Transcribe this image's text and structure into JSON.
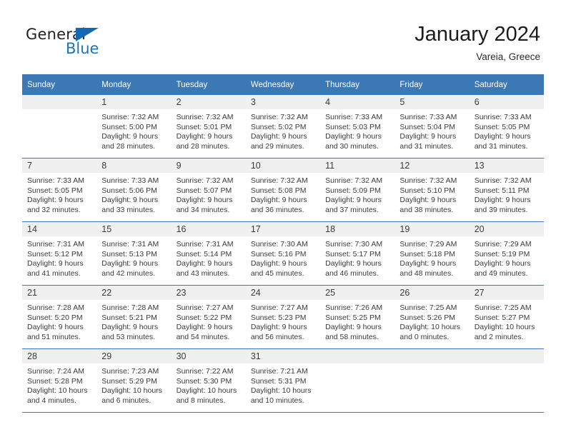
{
  "brand": {
    "name_top": "General",
    "name_bottom": "Blue",
    "triangle_color": "#1268b3",
    "blue_text_color": "#1b75bb"
  },
  "header": {
    "month_title": "January 2024",
    "location": "Vareia, Greece"
  },
  "colors": {
    "header_blue": "#3b78b5",
    "daynum_band": "#f0f0f0",
    "text": "#3a3a3a"
  },
  "weekday_headers": [
    "Sunday",
    "Monday",
    "Tuesday",
    "Wednesday",
    "Thursday",
    "Friday",
    "Saturday"
  ],
  "weeks": [
    [
      {
        "day": "",
        "sunrise": "",
        "sunset": "",
        "daylight_line1": "",
        "daylight_line2": ""
      },
      {
        "day": "1",
        "sunrise": "Sunrise: 7:32 AM",
        "sunset": "Sunset: 5:00 PM",
        "daylight_line1": "Daylight: 9 hours",
        "daylight_line2": "and 28 minutes."
      },
      {
        "day": "2",
        "sunrise": "Sunrise: 7:32 AM",
        "sunset": "Sunset: 5:01 PM",
        "daylight_line1": "Daylight: 9 hours",
        "daylight_line2": "and 28 minutes."
      },
      {
        "day": "3",
        "sunrise": "Sunrise: 7:32 AM",
        "sunset": "Sunset: 5:02 PM",
        "daylight_line1": "Daylight: 9 hours",
        "daylight_line2": "and 29 minutes."
      },
      {
        "day": "4",
        "sunrise": "Sunrise: 7:33 AM",
        "sunset": "Sunset: 5:03 PM",
        "daylight_line1": "Daylight: 9 hours",
        "daylight_line2": "and 30 minutes."
      },
      {
        "day": "5",
        "sunrise": "Sunrise: 7:33 AM",
        "sunset": "Sunset: 5:04 PM",
        "daylight_line1": "Daylight: 9 hours",
        "daylight_line2": "and 31 minutes."
      },
      {
        "day": "6",
        "sunrise": "Sunrise: 7:33 AM",
        "sunset": "Sunset: 5:05 PM",
        "daylight_line1": "Daylight: 9 hours",
        "daylight_line2": "and 31 minutes."
      }
    ],
    [
      {
        "day": "7",
        "sunrise": "Sunrise: 7:33 AM",
        "sunset": "Sunset: 5:05 PM",
        "daylight_line1": "Daylight: 9 hours",
        "daylight_line2": "and 32 minutes."
      },
      {
        "day": "8",
        "sunrise": "Sunrise: 7:33 AM",
        "sunset": "Sunset: 5:06 PM",
        "daylight_line1": "Daylight: 9 hours",
        "daylight_line2": "and 33 minutes."
      },
      {
        "day": "9",
        "sunrise": "Sunrise: 7:32 AM",
        "sunset": "Sunset: 5:07 PM",
        "daylight_line1": "Daylight: 9 hours",
        "daylight_line2": "and 34 minutes."
      },
      {
        "day": "10",
        "sunrise": "Sunrise: 7:32 AM",
        "sunset": "Sunset: 5:08 PM",
        "daylight_line1": "Daylight: 9 hours",
        "daylight_line2": "and 36 minutes."
      },
      {
        "day": "11",
        "sunrise": "Sunrise: 7:32 AM",
        "sunset": "Sunset: 5:09 PM",
        "daylight_line1": "Daylight: 9 hours",
        "daylight_line2": "and 37 minutes."
      },
      {
        "day": "12",
        "sunrise": "Sunrise: 7:32 AM",
        "sunset": "Sunset: 5:10 PM",
        "daylight_line1": "Daylight: 9 hours",
        "daylight_line2": "and 38 minutes."
      },
      {
        "day": "13",
        "sunrise": "Sunrise: 7:32 AM",
        "sunset": "Sunset: 5:11 PM",
        "daylight_line1": "Daylight: 9 hours",
        "daylight_line2": "and 39 minutes."
      }
    ],
    [
      {
        "day": "14",
        "sunrise": "Sunrise: 7:31 AM",
        "sunset": "Sunset: 5:12 PM",
        "daylight_line1": "Daylight: 9 hours",
        "daylight_line2": "and 41 minutes."
      },
      {
        "day": "15",
        "sunrise": "Sunrise: 7:31 AM",
        "sunset": "Sunset: 5:13 PM",
        "daylight_line1": "Daylight: 9 hours",
        "daylight_line2": "and 42 minutes."
      },
      {
        "day": "16",
        "sunrise": "Sunrise: 7:31 AM",
        "sunset": "Sunset: 5:14 PM",
        "daylight_line1": "Daylight: 9 hours",
        "daylight_line2": "and 43 minutes."
      },
      {
        "day": "17",
        "sunrise": "Sunrise: 7:30 AM",
        "sunset": "Sunset: 5:16 PM",
        "daylight_line1": "Daylight: 9 hours",
        "daylight_line2": "and 45 minutes."
      },
      {
        "day": "18",
        "sunrise": "Sunrise: 7:30 AM",
        "sunset": "Sunset: 5:17 PM",
        "daylight_line1": "Daylight: 9 hours",
        "daylight_line2": "and 46 minutes."
      },
      {
        "day": "19",
        "sunrise": "Sunrise: 7:29 AM",
        "sunset": "Sunset: 5:18 PM",
        "daylight_line1": "Daylight: 9 hours",
        "daylight_line2": "and 48 minutes."
      },
      {
        "day": "20",
        "sunrise": "Sunrise: 7:29 AM",
        "sunset": "Sunset: 5:19 PM",
        "daylight_line1": "Daylight: 9 hours",
        "daylight_line2": "and 49 minutes."
      }
    ],
    [
      {
        "day": "21",
        "sunrise": "Sunrise: 7:28 AM",
        "sunset": "Sunset: 5:20 PM",
        "daylight_line1": "Daylight: 9 hours",
        "daylight_line2": "and 51 minutes."
      },
      {
        "day": "22",
        "sunrise": "Sunrise: 7:28 AM",
        "sunset": "Sunset: 5:21 PM",
        "daylight_line1": "Daylight: 9 hours",
        "daylight_line2": "and 53 minutes."
      },
      {
        "day": "23",
        "sunrise": "Sunrise: 7:27 AM",
        "sunset": "Sunset: 5:22 PM",
        "daylight_line1": "Daylight: 9 hours",
        "daylight_line2": "and 54 minutes."
      },
      {
        "day": "24",
        "sunrise": "Sunrise: 7:27 AM",
        "sunset": "Sunset: 5:23 PM",
        "daylight_line1": "Daylight: 9 hours",
        "daylight_line2": "and 56 minutes."
      },
      {
        "day": "25",
        "sunrise": "Sunrise: 7:26 AM",
        "sunset": "Sunset: 5:25 PM",
        "daylight_line1": "Daylight: 9 hours",
        "daylight_line2": "and 58 minutes."
      },
      {
        "day": "26",
        "sunrise": "Sunrise: 7:25 AM",
        "sunset": "Sunset: 5:26 PM",
        "daylight_line1": "Daylight: 10 hours",
        "daylight_line2": "and 0 minutes."
      },
      {
        "day": "27",
        "sunrise": "Sunrise: 7:25 AM",
        "sunset": "Sunset: 5:27 PM",
        "daylight_line1": "Daylight: 10 hours",
        "daylight_line2": "and 2 minutes."
      }
    ],
    [
      {
        "day": "28",
        "sunrise": "Sunrise: 7:24 AM",
        "sunset": "Sunset: 5:28 PM",
        "daylight_line1": "Daylight: 10 hours",
        "daylight_line2": "and 4 minutes."
      },
      {
        "day": "29",
        "sunrise": "Sunrise: 7:23 AM",
        "sunset": "Sunset: 5:29 PM",
        "daylight_line1": "Daylight: 10 hours",
        "daylight_line2": "and 6 minutes."
      },
      {
        "day": "30",
        "sunrise": "Sunrise: 7:22 AM",
        "sunset": "Sunset: 5:30 PM",
        "daylight_line1": "Daylight: 10 hours",
        "daylight_line2": "and 8 minutes."
      },
      {
        "day": "31",
        "sunrise": "Sunrise: 7:21 AM",
        "sunset": "Sunset: 5:31 PM",
        "daylight_line1": "Daylight: 10 hours",
        "daylight_line2": "and 10 minutes."
      },
      {
        "day": "",
        "sunrise": "",
        "sunset": "",
        "daylight_line1": "",
        "daylight_line2": ""
      },
      {
        "day": "",
        "sunrise": "",
        "sunset": "",
        "daylight_line1": "",
        "daylight_line2": ""
      },
      {
        "day": "",
        "sunrise": "",
        "sunset": "",
        "daylight_line1": "",
        "daylight_line2": ""
      }
    ]
  ]
}
